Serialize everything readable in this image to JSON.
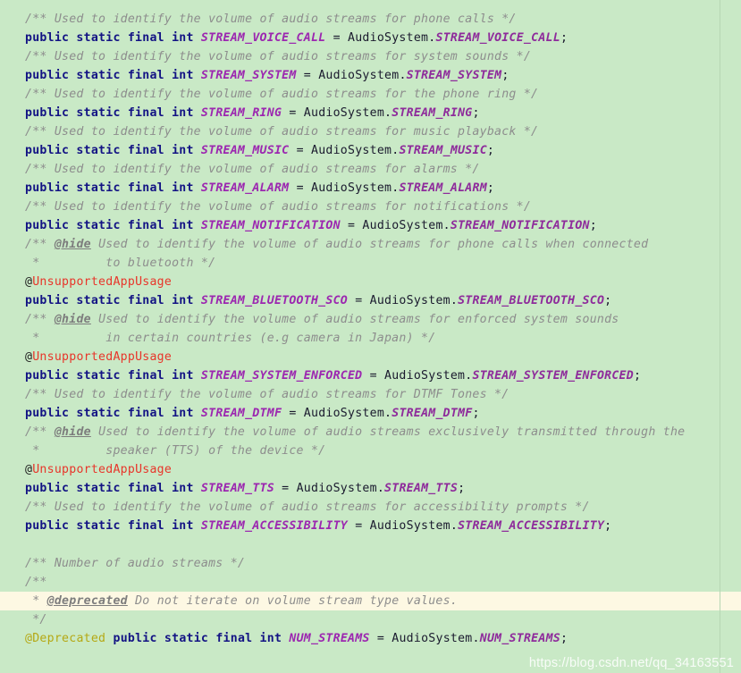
{
  "editor": {
    "language": "java",
    "background_color": "#c9e9c6",
    "highlight_line_color": "#fdf8e3",
    "margin_guide_color": "#b6d6b3",
    "colors": {
      "comment": "#8d8d8d",
      "keyword": "#131384",
      "field_name": "#9c27b0",
      "static_member": "#8e2b9b",
      "annotation_red": "#e8352a",
      "annotation_yellow": "#b5a814",
      "plain_text": "#1a1a2e"
    },
    "highlighted_line_index": 42
  },
  "watermark": {
    "text": "https://blog.csdn.net/qq_34163551"
  },
  "lines": [
    {
      "i": 0,
      "type": "comment",
      "text": "/** Used to identify the volume of audio streams for phone calls */"
    },
    {
      "i": 1,
      "type": "decl",
      "modifiers": "public static final int",
      "name": "STREAM_VOICE_CALL",
      "owner": "AudioSystem",
      "member": "STREAM_VOICE_CALL"
    },
    {
      "i": 2,
      "type": "comment",
      "text": "/** Used to identify the volume of audio streams for system sounds */"
    },
    {
      "i": 3,
      "type": "decl",
      "modifiers": "public static final int",
      "name": "STREAM_SYSTEM",
      "owner": "AudioSystem",
      "member": "STREAM_SYSTEM"
    },
    {
      "i": 4,
      "type": "comment",
      "text": "/** Used to identify the volume of audio streams for the phone ring */"
    },
    {
      "i": 5,
      "type": "decl",
      "modifiers": "public static final int",
      "name": "STREAM_RING",
      "owner": "AudioSystem",
      "member": "STREAM_RING"
    },
    {
      "i": 6,
      "type": "comment",
      "text": "/** Used to identify the volume of audio streams for music playback */"
    },
    {
      "i": 7,
      "type": "decl",
      "modifiers": "public static final int",
      "name": "STREAM_MUSIC",
      "owner": "AudioSystem",
      "member": "STREAM_MUSIC"
    },
    {
      "i": 8,
      "type": "comment",
      "text": "/** Used to identify the volume of audio streams for alarms */"
    },
    {
      "i": 9,
      "type": "decl",
      "modifiers": "public static final int",
      "name": "STREAM_ALARM",
      "owner": "AudioSystem",
      "member": "STREAM_ALARM"
    },
    {
      "i": 10,
      "type": "comment",
      "text": "/** Used to identify the volume of audio streams for notifications */"
    },
    {
      "i": 11,
      "type": "decl",
      "modifiers": "public static final int",
      "name": "STREAM_NOTIFICATION",
      "owner": "AudioSystem",
      "member": "STREAM_NOTIFICATION"
    },
    {
      "i": 12,
      "type": "comment_tag",
      "prefix": "/** ",
      "tag": "@hide",
      "rest": " Used to identify the volume of audio streams for phone calls when connected"
    },
    {
      "i": 13,
      "type": "comment",
      "text": " *         to bluetooth */"
    },
    {
      "i": 14,
      "type": "annotation",
      "at": "@",
      "name": "UnsupportedAppUsage",
      "color": "red"
    },
    {
      "i": 15,
      "type": "decl",
      "modifiers": "public static final int",
      "name": "STREAM_BLUETOOTH_SCO",
      "owner": "AudioSystem",
      "member": "STREAM_BLUETOOTH_SCO"
    },
    {
      "i": 16,
      "type": "comment_tag",
      "prefix": "/** ",
      "tag": "@hide",
      "rest": " Used to identify the volume of audio streams for enforced system sounds"
    },
    {
      "i": 17,
      "type": "comment",
      "text": " *         in certain countries (e.g camera in Japan) */"
    },
    {
      "i": 18,
      "type": "annotation",
      "at": "@",
      "name": "UnsupportedAppUsage",
      "color": "red"
    },
    {
      "i": 19,
      "type": "decl",
      "modifiers": "public static final int",
      "name": "STREAM_SYSTEM_ENFORCED",
      "owner": "AudioSystem",
      "member": "STREAM_SYSTEM_ENFORCED"
    },
    {
      "i": 20,
      "type": "comment",
      "text": "/** Used to identify the volume of audio streams for DTMF Tones */"
    },
    {
      "i": 21,
      "type": "decl",
      "modifiers": "public static final int",
      "name": "STREAM_DTMF",
      "owner": "AudioSystem",
      "member": "STREAM_DTMF"
    },
    {
      "i": 22,
      "type": "comment_tag",
      "prefix": "/** ",
      "tag": "@hide",
      "rest": " Used to identify the volume of audio streams exclusively transmitted through the"
    },
    {
      "i": 23,
      "type": "comment",
      "text": " *         speaker (TTS) of the device */"
    },
    {
      "i": 24,
      "type": "annotation",
      "at": "@",
      "name": "UnsupportedAppUsage",
      "color": "red"
    },
    {
      "i": 25,
      "type": "decl",
      "modifiers": "public static final int",
      "name": "STREAM_TTS",
      "owner": "AudioSystem",
      "member": "STREAM_TTS"
    },
    {
      "i": 26,
      "type": "comment",
      "text": "/** Used to identify the volume of audio streams for accessibility prompts */"
    },
    {
      "i": 27,
      "type": "decl",
      "modifiers": "public static final int",
      "name": "STREAM_ACCESSIBILITY",
      "owner": "AudioSystem",
      "member": "STREAM_ACCESSIBILITY"
    },
    {
      "i": 28,
      "type": "blank",
      "text": ""
    },
    {
      "i": 29,
      "type": "comment",
      "text": "/** Number of audio streams */"
    },
    {
      "i": 30,
      "type": "comment",
      "text": "/**"
    },
    {
      "i": 31,
      "type": "comment_tag",
      "prefix": " * ",
      "tag": "@deprecated",
      "rest": " Do not iterate on volume stream type values.",
      "highlight": true
    },
    {
      "i": 32,
      "type": "comment",
      "text": " */"
    },
    {
      "i": 33,
      "type": "decl_annotated",
      "annotation_at": "@",
      "annotation_name": "Deprecated",
      "annotation_color": "yellow",
      "modifiers": "public static final int",
      "name": "NUM_STREAMS",
      "owner": "AudioSystem",
      "member": "NUM_STREAMS"
    }
  ]
}
